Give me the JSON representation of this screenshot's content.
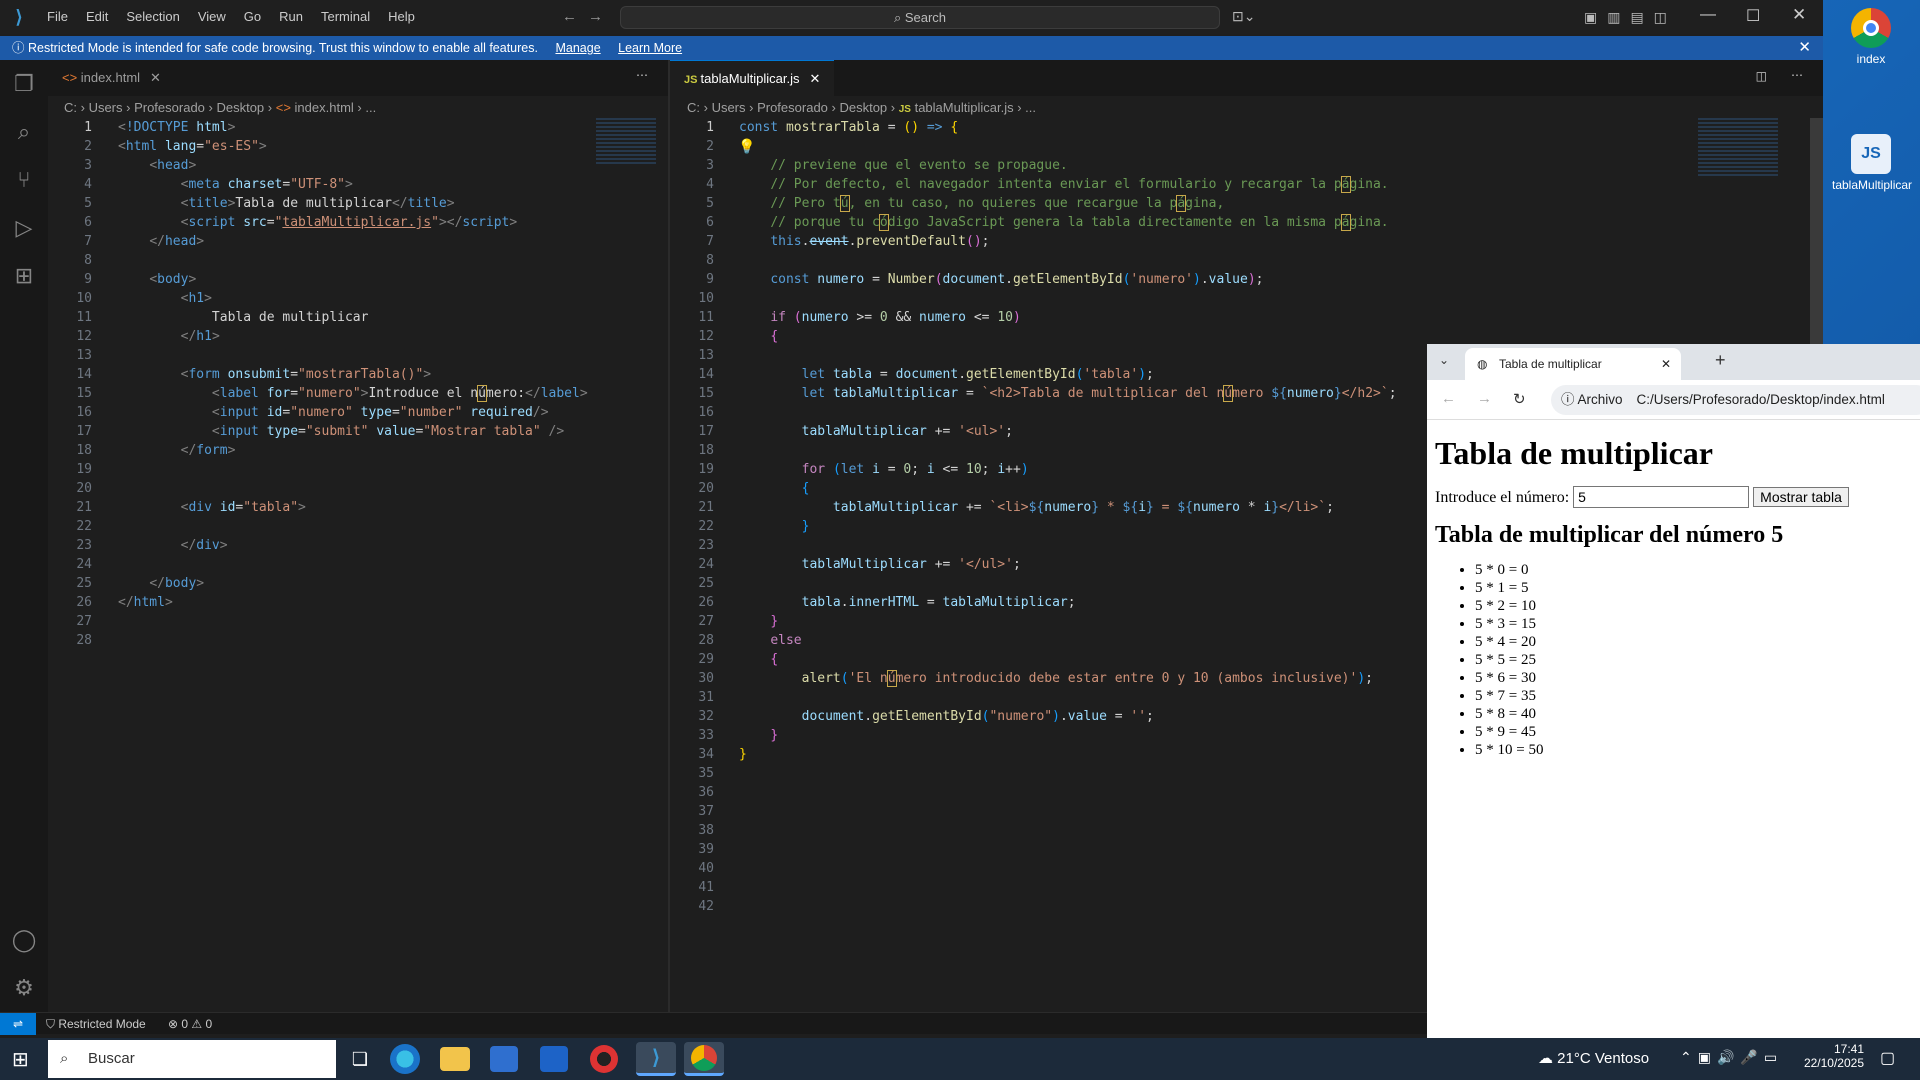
{
  "desktop": {
    "icons": [
      {
        "label": "index",
        "icon": "chrome-icon"
      },
      {
        "label": "tablaMultiplicar",
        "icon": "js-file-icon"
      }
    ]
  },
  "vscode": {
    "menu": [
      "File",
      "Edit",
      "Selection",
      "View",
      "Go",
      "Run",
      "Terminal",
      "Help"
    ],
    "search_label": "Search",
    "banner": {
      "text": "Restricted Mode is intended for safe code browsing. Trust this window to enable all features.",
      "manage": "Manage",
      "learn_more": "Learn More"
    },
    "left": {
      "tab": "index.html",
      "breadcrumb": [
        "C:",
        "Users",
        "Profesorado",
        "Desktop",
        "index.html",
        "..."
      ],
      "line_count": 28,
      "current_line": 1
    },
    "right": {
      "tab": "tablaMultiplicar.js",
      "breadcrumb": [
        "C:",
        "Users",
        "Profesorado",
        "Desktop",
        "tablaMultiplicar.js",
        "..."
      ],
      "line_count": 42,
      "current_line": 1
    },
    "status": {
      "mode": "Restricted Mode",
      "errors": "0",
      "warnings": "0"
    }
  },
  "browser": {
    "tab_title": "Tabla de multiplicar",
    "url_label": "Archivo",
    "url": "C:/Users/Profesorado/Desktop/index.html",
    "page": {
      "h1": "Tabla de multiplicar",
      "label": "Introduce el número:",
      "input_value": "5",
      "button": "Mostrar tabla",
      "h2": "Tabla de multiplicar del número 5",
      "items": [
        "5 * 0 = 0",
        "5 * 1 = 5",
        "5 * 2 = 10",
        "5 * 3 = 15",
        "5 * 4 = 20",
        "5 * 5 = 25",
        "5 * 6 = 30",
        "5 * 7 = 35",
        "5 * 8 = 40",
        "5 * 9 = 45",
        "5 * 10 = 50"
      ]
    }
  },
  "taskbar": {
    "search": "Buscar",
    "weather": "21°C  Ventoso",
    "time": "17:41",
    "date": "22/10/2025"
  }
}
